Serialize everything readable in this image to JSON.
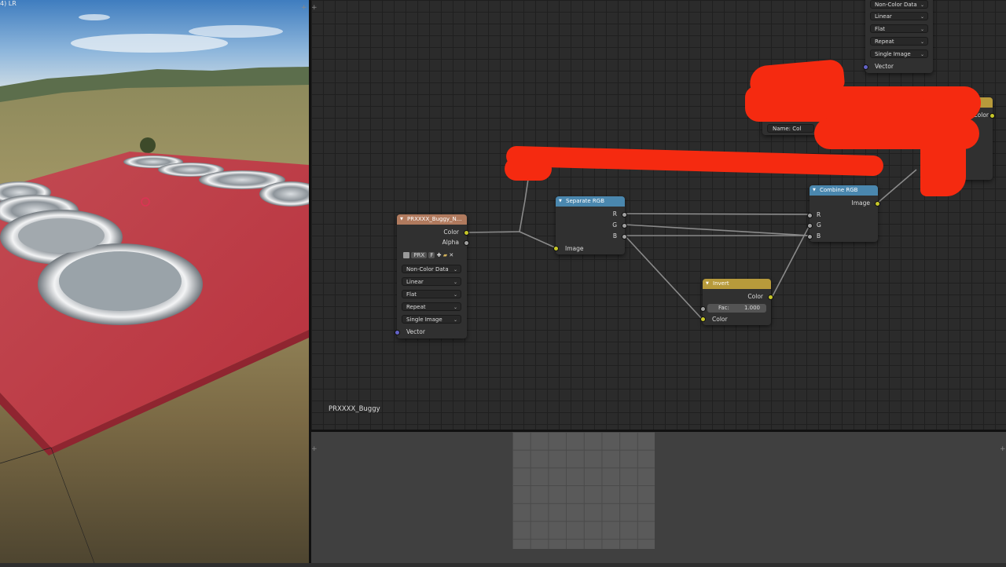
{
  "viewport": {
    "corner_label": "4) LR"
  },
  "node_editor": {
    "material_label": "PRXXXX_Buggy",
    "image_texture_node": {
      "title": "PRXXXX_Buggy_N...",
      "outputs": [
        "Color",
        "Alpha"
      ],
      "image_name": "PRX",
      "fake_user": "F",
      "color_space": "Non-Color Data",
      "interpolation": "Linear",
      "projection": "Flat",
      "extension": "Repeat",
      "source": "Single Image",
      "input": "Vector"
    },
    "top_image_node": {
      "color_space": "Non-Color Data",
      "interpolation": "Linear",
      "projection": "Flat",
      "extension": "Repeat",
      "source": "Single Image",
      "input": "Vector"
    },
    "partial_node": {
      "name_label": "Name:",
      "name_value": "Col"
    },
    "right_node": {
      "output": "Color"
    },
    "separate_rgb": {
      "title": "Separate RGB",
      "outputs": [
        "R",
        "G",
        "B"
      ],
      "input": "Image"
    },
    "combine_rgb": {
      "title": "Combine RGB",
      "output": "Image",
      "inputs": [
        "R",
        "G",
        "B"
      ]
    },
    "invert": {
      "title": "Invert",
      "output": "Color",
      "fac_label": "Fac:",
      "fac_value": "1.000",
      "input": "Color"
    }
  },
  "colors": {
    "texture_header": "#b07a5e",
    "converter_header": "#4a87ae",
    "color_header": "#b79a3b",
    "red_scribble": "#f52a10",
    "socket_color": "#c7c729",
    "socket_float": "#a1a1a1",
    "socket_vector": "#6363c7"
  }
}
